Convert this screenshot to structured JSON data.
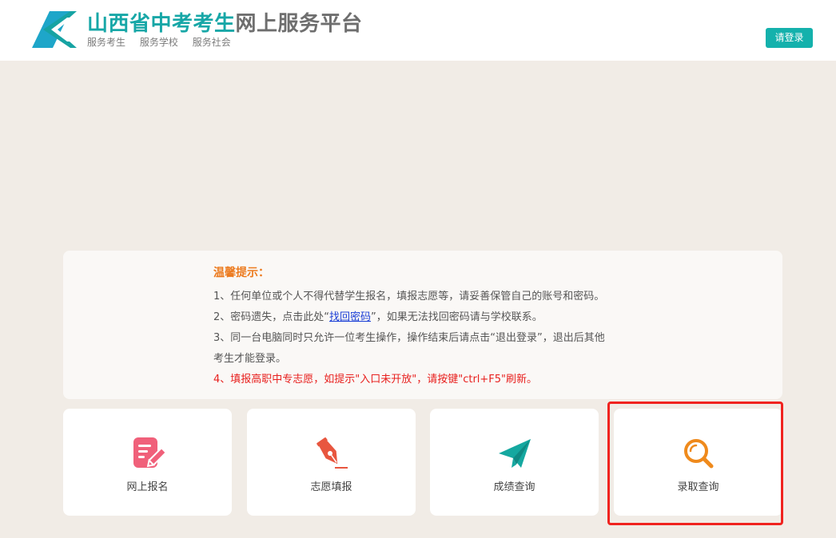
{
  "header": {
    "title_teal": "山西省中考考生",
    "title_gray": "网上服务平台",
    "subtitle_items": [
      "服务考生",
      "服务学校",
      "服务社会"
    ],
    "login_label": "请登录",
    "logo_color": "#17a7a7"
  },
  "notice": {
    "title": "温馨提示：",
    "line1": "1、任何单位或个人不得代替学生报名，填报志愿等，请妥善保管自己的账号和密码。",
    "line2_prefix": "2、密码遗失，点击此处“",
    "line2_link": "找回密码",
    "line2_suffix": "”，如果无法找回密码请与学校联系。",
    "line3a": "3、同一台电脑同时只允许一位考生操作，操作结束后请点击“退出登录”，退出后其他",
    "line3b": "考生才能登录。",
    "line4": "4、填报高职中专志愿，如提示\"入口未开放\"，请按键\"ctrl+F5\"刷新。"
  },
  "cards": [
    {
      "label": "网上报名",
      "icon": "edit-note-icon",
      "color": "#f0607a"
    },
    {
      "label": "志愿填报",
      "icon": "pen-nib-icon",
      "color": "#e8563f"
    },
    {
      "label": "成绩查询",
      "icon": "paper-plane-icon",
      "color": "#15a8a0"
    },
    {
      "label": "录取查询",
      "icon": "magnifier-icon",
      "color": "#ef8a1c"
    }
  ],
  "colors": {
    "accent": "#14b1ac",
    "background": "#f1ece6",
    "notice_title": "#ec7a1e",
    "warning_red": "#e8201e",
    "highlight": "#f0231f"
  }
}
